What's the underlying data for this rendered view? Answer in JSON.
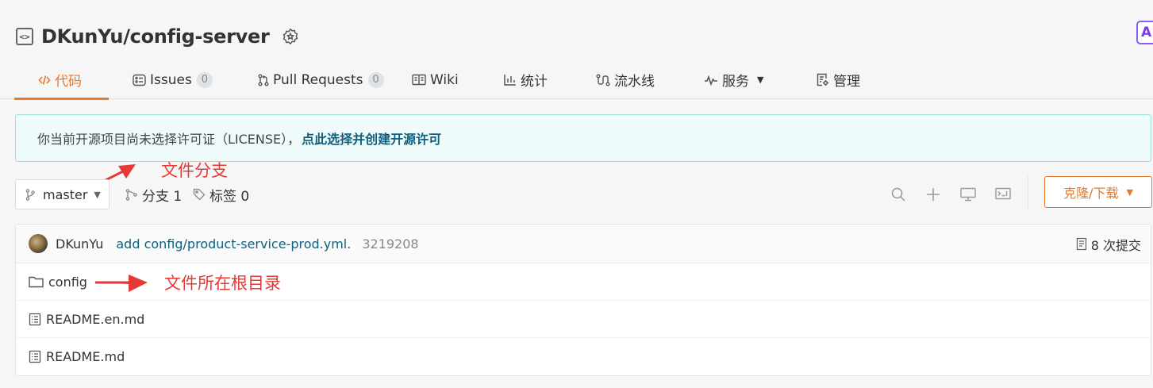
{
  "repo": {
    "name": "DKunYu/config-server",
    "corner_badge": "A"
  },
  "nav": {
    "tabs": [
      {
        "label": "代码",
        "icon": "code-icon",
        "active": true
      },
      {
        "label": "Issues",
        "count": "0",
        "icon": "issues-icon"
      },
      {
        "label": "Pull Requests",
        "count": "0",
        "icon": "pull-request-icon"
      },
      {
        "label": "Wiki",
        "icon": "book-icon"
      },
      {
        "label": "统计",
        "icon": "bar-chart-icon"
      },
      {
        "label": "流水线",
        "icon": "pipeline-icon"
      },
      {
        "label": "服务",
        "icon": "pulse-icon",
        "dropdown": true
      },
      {
        "label": "管理",
        "icon": "settings-doc-icon"
      }
    ]
  },
  "license_notice": {
    "text": "你当前开源项目尚未选择许可证（LICENSE），",
    "link": "点此选择并创建开源许可"
  },
  "annotations": {
    "branch": "文件分支",
    "root_dir": "文件所在根目录"
  },
  "branch_bar": {
    "branch": "master",
    "branches": "分支 1",
    "tags": "标签 0",
    "clone_label": "克隆/下载"
  },
  "commit": {
    "author": "DKunYu",
    "message": "add config/product-service-prod.yml.",
    "sha": "3219208",
    "count_label": "8 次提交"
  },
  "files": [
    {
      "name": "config",
      "type": "folder"
    },
    {
      "name": "README.en.md",
      "type": "file"
    },
    {
      "name": "README.md",
      "type": "file"
    }
  ],
  "colors": {
    "accent": "#e8772e",
    "link": "#0e5f7d",
    "annotation": "#e53935"
  }
}
